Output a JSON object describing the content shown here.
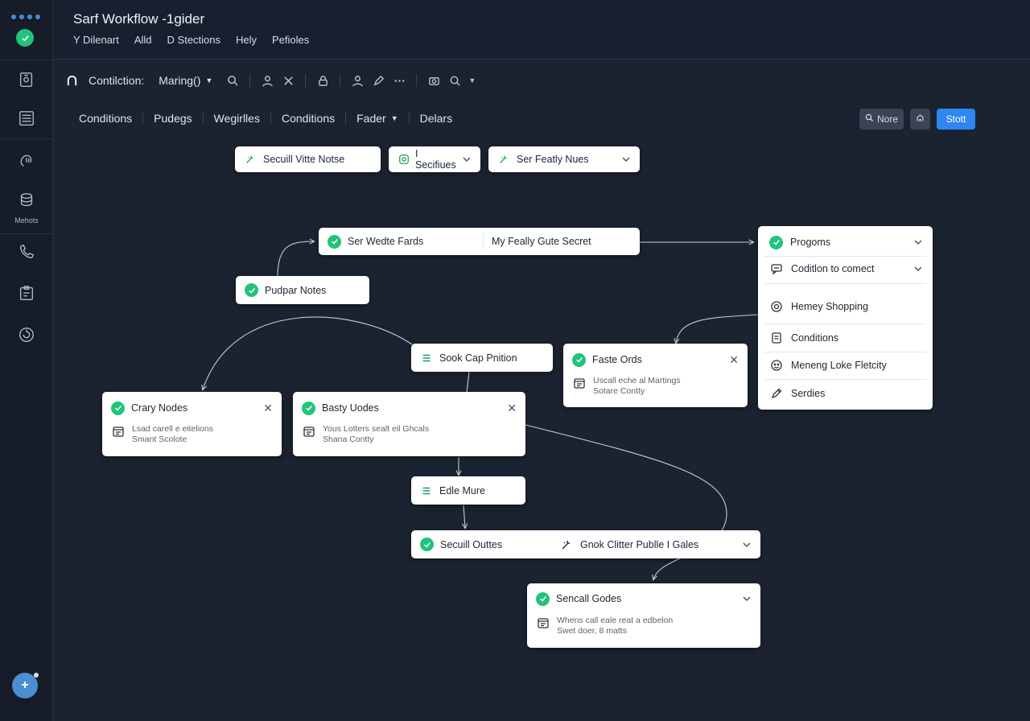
{
  "window": {
    "title": "Sarf Workflow -1gider",
    "menu": [
      "Y Dilenart",
      "Alld",
      "D Stections",
      "Hely",
      "Pefioles"
    ]
  },
  "rail": {
    "items": [
      {
        "icon": "document-icon",
        "label": ""
      },
      {
        "icon": "list-icon",
        "label": ""
      },
      {
        "icon": "hand-icon",
        "label": ""
      },
      {
        "icon": "database-icon",
        "label": "Mehots"
      },
      {
        "icon": "phone-icon",
        "label": ""
      },
      {
        "icon": "clipboard-icon",
        "label": ""
      },
      {
        "icon": "refresh-icon",
        "label": ""
      }
    ],
    "fab_label": "+"
  },
  "toolbar": {
    "label": "Contilction:",
    "dropdown": "Maring()"
  },
  "tabs": [
    "Conditions",
    "Pudegs",
    "Wegirlles",
    "Conditions",
    "Fader",
    "Delars"
  ],
  "actions": {
    "more": "Nore",
    "start": "Stott"
  },
  "filters": [
    {
      "label": "Secuill Vitte Notse"
    },
    {
      "label": "I Secifiues"
    },
    {
      "label": "Ser Featly Nues"
    }
  ],
  "nodes": {
    "top": {
      "left": "Ser Wedte Fards",
      "right": "My Feally Gute Secret"
    },
    "pudpar": "Pudpar Notes",
    "sook": "Sook Cap Pnition",
    "crary": {
      "title": "Crary Nodes",
      "line1": "Lsad carell e eitelions",
      "line2": "Smant Scolote"
    },
    "basty": {
      "title": "Basty Uodes",
      "line1": "Yous Lotters sealt eil Ghcals",
      "line2": "Shana Contty"
    },
    "faste": {
      "title": "Faste Ords",
      "line1": "Uscall eche al Martings",
      "line2": "Sotare Contty"
    },
    "edle": "Edle Mure",
    "secuill": {
      "left": "Secuill Outtes",
      "right": "Gnok Clitter Publle I Gales"
    },
    "sencall": {
      "title": "Sencall Godes",
      "line1": "Whens call eale reat a edbelon",
      "line2": "Swet doer, 8 matts"
    }
  },
  "panel": {
    "items": [
      {
        "label": "Progoms"
      },
      {
        "label": "Coditlon to comect"
      },
      {
        "label": "Hemey Shopping"
      },
      {
        "label": "Conditions"
      },
      {
        "label": "Meneng Loke Fletcity"
      },
      {
        "label": "Serdies"
      }
    ]
  },
  "colors": {
    "background": "#1b2230",
    "accent_green": "#22c37a",
    "accent_blue": "#2f86f0"
  }
}
